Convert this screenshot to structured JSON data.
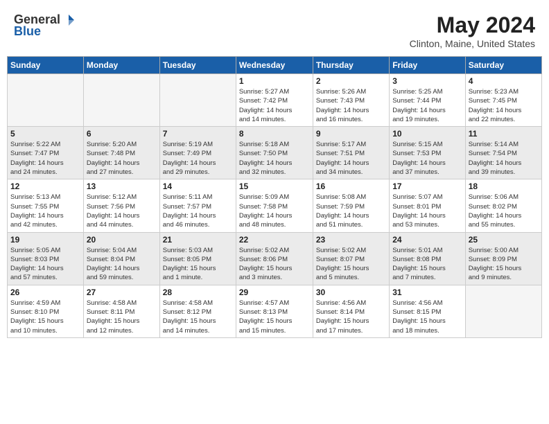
{
  "logo": {
    "general": "General",
    "blue": "Blue"
  },
  "title": "May 2024",
  "location": "Clinton, Maine, United States",
  "days_of_week": [
    "Sunday",
    "Monday",
    "Tuesday",
    "Wednesday",
    "Thursday",
    "Friday",
    "Saturday"
  ],
  "weeks": [
    [
      {
        "day": "",
        "info": ""
      },
      {
        "day": "",
        "info": ""
      },
      {
        "day": "",
        "info": ""
      },
      {
        "day": "1",
        "info": "Sunrise: 5:27 AM\nSunset: 7:42 PM\nDaylight: 14 hours\nand 14 minutes."
      },
      {
        "day": "2",
        "info": "Sunrise: 5:26 AM\nSunset: 7:43 PM\nDaylight: 14 hours\nand 16 minutes."
      },
      {
        "day": "3",
        "info": "Sunrise: 5:25 AM\nSunset: 7:44 PM\nDaylight: 14 hours\nand 19 minutes."
      },
      {
        "day": "4",
        "info": "Sunrise: 5:23 AM\nSunset: 7:45 PM\nDaylight: 14 hours\nand 22 minutes."
      }
    ],
    [
      {
        "day": "5",
        "info": "Sunrise: 5:22 AM\nSunset: 7:47 PM\nDaylight: 14 hours\nand 24 minutes."
      },
      {
        "day": "6",
        "info": "Sunrise: 5:20 AM\nSunset: 7:48 PM\nDaylight: 14 hours\nand 27 minutes."
      },
      {
        "day": "7",
        "info": "Sunrise: 5:19 AM\nSunset: 7:49 PM\nDaylight: 14 hours\nand 29 minutes."
      },
      {
        "day": "8",
        "info": "Sunrise: 5:18 AM\nSunset: 7:50 PM\nDaylight: 14 hours\nand 32 minutes."
      },
      {
        "day": "9",
        "info": "Sunrise: 5:17 AM\nSunset: 7:51 PM\nDaylight: 14 hours\nand 34 minutes."
      },
      {
        "day": "10",
        "info": "Sunrise: 5:15 AM\nSunset: 7:53 PM\nDaylight: 14 hours\nand 37 minutes."
      },
      {
        "day": "11",
        "info": "Sunrise: 5:14 AM\nSunset: 7:54 PM\nDaylight: 14 hours\nand 39 minutes."
      }
    ],
    [
      {
        "day": "12",
        "info": "Sunrise: 5:13 AM\nSunset: 7:55 PM\nDaylight: 14 hours\nand 42 minutes."
      },
      {
        "day": "13",
        "info": "Sunrise: 5:12 AM\nSunset: 7:56 PM\nDaylight: 14 hours\nand 44 minutes."
      },
      {
        "day": "14",
        "info": "Sunrise: 5:11 AM\nSunset: 7:57 PM\nDaylight: 14 hours\nand 46 minutes."
      },
      {
        "day": "15",
        "info": "Sunrise: 5:09 AM\nSunset: 7:58 PM\nDaylight: 14 hours\nand 48 minutes."
      },
      {
        "day": "16",
        "info": "Sunrise: 5:08 AM\nSunset: 7:59 PM\nDaylight: 14 hours\nand 51 minutes."
      },
      {
        "day": "17",
        "info": "Sunrise: 5:07 AM\nSunset: 8:01 PM\nDaylight: 14 hours\nand 53 minutes."
      },
      {
        "day": "18",
        "info": "Sunrise: 5:06 AM\nSunset: 8:02 PM\nDaylight: 14 hours\nand 55 minutes."
      }
    ],
    [
      {
        "day": "19",
        "info": "Sunrise: 5:05 AM\nSunset: 8:03 PM\nDaylight: 14 hours\nand 57 minutes."
      },
      {
        "day": "20",
        "info": "Sunrise: 5:04 AM\nSunset: 8:04 PM\nDaylight: 14 hours\nand 59 minutes."
      },
      {
        "day": "21",
        "info": "Sunrise: 5:03 AM\nSunset: 8:05 PM\nDaylight: 15 hours\nand 1 minute."
      },
      {
        "day": "22",
        "info": "Sunrise: 5:02 AM\nSunset: 8:06 PM\nDaylight: 15 hours\nand 3 minutes."
      },
      {
        "day": "23",
        "info": "Sunrise: 5:02 AM\nSunset: 8:07 PM\nDaylight: 15 hours\nand 5 minutes."
      },
      {
        "day": "24",
        "info": "Sunrise: 5:01 AM\nSunset: 8:08 PM\nDaylight: 15 hours\nand 7 minutes."
      },
      {
        "day": "25",
        "info": "Sunrise: 5:00 AM\nSunset: 8:09 PM\nDaylight: 15 hours\nand 9 minutes."
      }
    ],
    [
      {
        "day": "26",
        "info": "Sunrise: 4:59 AM\nSunset: 8:10 PM\nDaylight: 15 hours\nand 10 minutes."
      },
      {
        "day": "27",
        "info": "Sunrise: 4:58 AM\nSunset: 8:11 PM\nDaylight: 15 hours\nand 12 minutes."
      },
      {
        "day": "28",
        "info": "Sunrise: 4:58 AM\nSunset: 8:12 PM\nDaylight: 15 hours\nand 14 minutes."
      },
      {
        "day": "29",
        "info": "Sunrise: 4:57 AM\nSunset: 8:13 PM\nDaylight: 15 hours\nand 15 minutes."
      },
      {
        "day": "30",
        "info": "Sunrise: 4:56 AM\nSunset: 8:14 PM\nDaylight: 15 hours\nand 17 minutes."
      },
      {
        "day": "31",
        "info": "Sunrise: 4:56 AM\nSunset: 8:15 PM\nDaylight: 15 hours\nand 18 minutes."
      },
      {
        "day": "",
        "info": ""
      }
    ]
  ]
}
